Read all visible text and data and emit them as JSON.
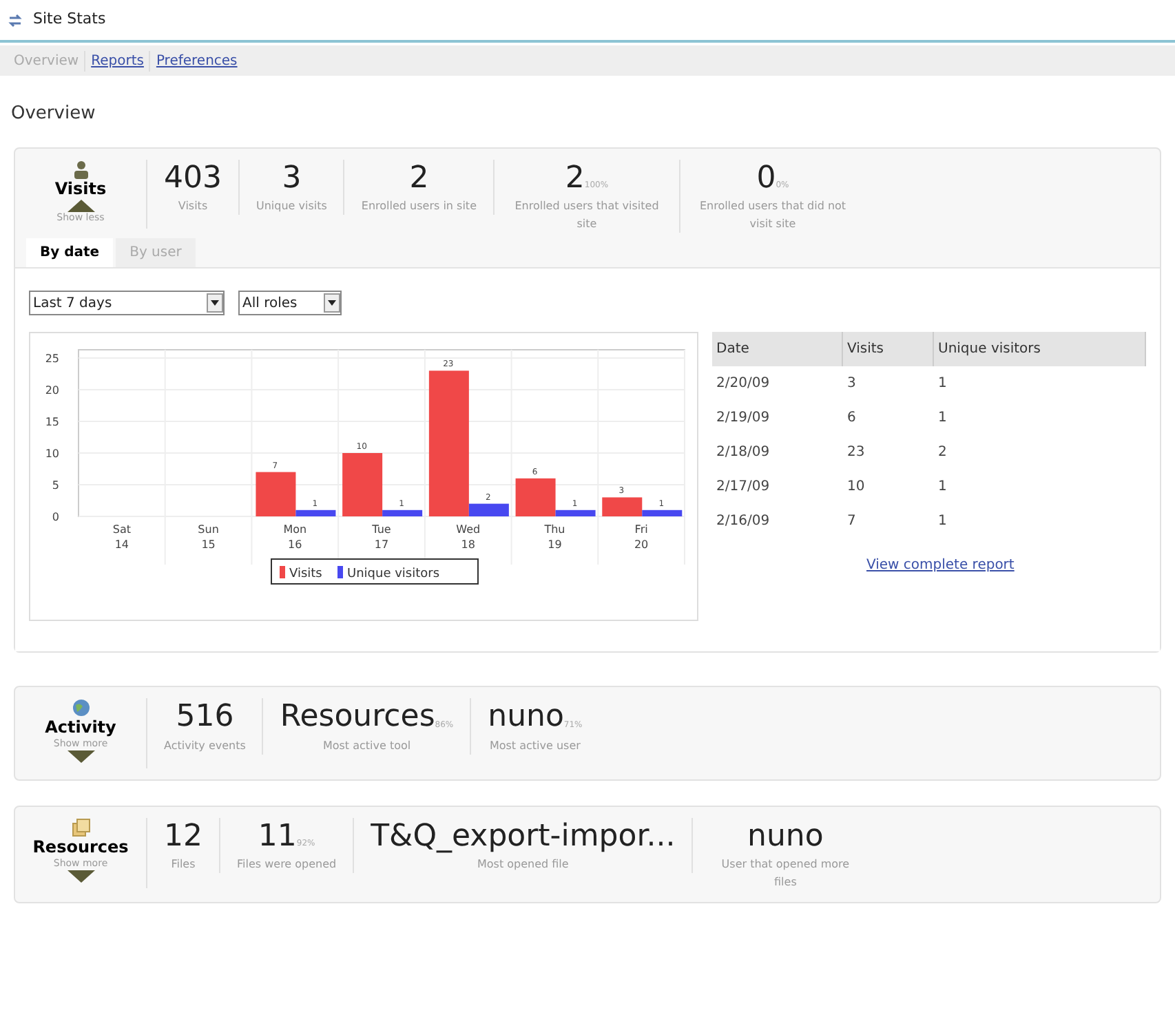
{
  "window": {
    "title": "Site Stats"
  },
  "nav": [
    {
      "label": "Overview",
      "selected": true
    },
    {
      "label": "Reports",
      "selected": false
    },
    {
      "label": "Preferences",
      "selected": false
    }
  ],
  "heading": "Overview",
  "visits_panel": {
    "title": "Visits",
    "toggle": "Show less",
    "expanded": true,
    "stats": [
      {
        "value": "403",
        "label": "Visits"
      },
      {
        "value": "3",
        "label": "Unique visits"
      },
      {
        "value": "2",
        "label": "Enrolled users in site"
      },
      {
        "value": "2",
        "percent": "100%",
        "label": "Enrolled users that visited site"
      },
      {
        "value": "0",
        "percent": "0%",
        "label": "Enrolled users that did not visit site"
      }
    ],
    "tabs": [
      {
        "label": "By date",
        "selected": true
      },
      {
        "label": "By user",
        "selected": false
      }
    ],
    "selects": [
      {
        "value": "Last 7 days"
      },
      {
        "value": "All roles"
      }
    ],
    "chart_data": {
      "type": "bar",
      "categories": [
        "Sat 14",
        "Sun 15",
        "Mon 16",
        "Tue 17",
        "Wed 18",
        "Thu 19",
        "Fri 20"
      ],
      "ylim": [
        0,
        25
      ],
      "yticks": [
        0,
        5,
        10,
        15,
        20,
        25
      ],
      "grid": true,
      "legend": "bottom",
      "series": [
        {
          "name": "Visits",
          "color": "#f04848",
          "values": [
            null,
            null,
            7,
            10,
            23,
            6,
            3
          ]
        },
        {
          "name": "Unique visitors",
          "color": "#4848f0",
          "values": [
            null,
            null,
            1,
            1,
            2,
            1,
            1
          ]
        }
      ],
      "value_labels": [
        [
          null,
          null,
          "7",
          "10",
          "23",
          "6",
          "3"
        ],
        [
          null,
          null,
          "1",
          "1",
          "2",
          "1",
          "1"
        ]
      ]
    },
    "table": {
      "columns": [
        "Date",
        "Visits",
        "Unique visitors"
      ],
      "rows": [
        [
          "2/20/09",
          "3",
          "1"
        ],
        [
          "2/19/09",
          "6",
          "1"
        ],
        [
          "2/18/09",
          "23",
          "2"
        ],
        [
          "2/17/09",
          "10",
          "1"
        ],
        [
          "2/16/09",
          "7",
          "1"
        ]
      ]
    },
    "report_link": "View complete report"
  },
  "activity_panel": {
    "title": "Activity",
    "toggle": "Show more",
    "expanded": false,
    "stats": [
      {
        "value": "516",
        "label": "Activity events"
      },
      {
        "value": "Resources",
        "percent": "86%",
        "label": "Most active tool"
      },
      {
        "value": "nuno",
        "percent": "71%",
        "label": "Most active user"
      }
    ]
  },
  "resources_panel": {
    "title": "Resources",
    "toggle": "Show more",
    "expanded": false,
    "stats": [
      {
        "value": "12",
        "label": "Files"
      },
      {
        "value": "11",
        "percent": "92%",
        "label": "Files were opened"
      },
      {
        "value": "T&Q_export-impor...",
        "label": "Most opened file"
      },
      {
        "value": "nuno",
        "label": "User that opened more files"
      }
    ]
  }
}
